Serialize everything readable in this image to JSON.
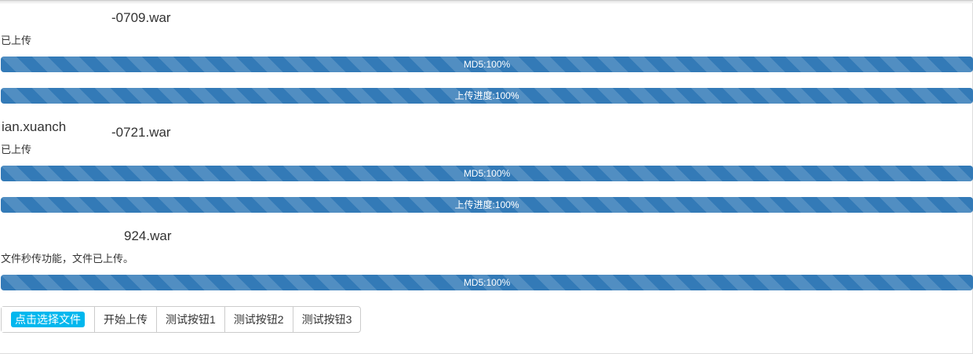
{
  "files": [
    {
      "name_visible": "-0709.war",
      "status": "已上传",
      "progress": [
        {
          "label": "MD5:100%",
          "percent": 100
        },
        {
          "label": "上传进度:100%",
          "percent": 100
        }
      ]
    },
    {
      "name_visible": "-0721.war",
      "name_prefix": "ian.xuanch",
      "status": "已上传",
      "progress": [
        {
          "label": "MD5:100%",
          "percent": 100
        },
        {
          "label": "上传进度:100%",
          "percent": 100
        }
      ]
    },
    {
      "name_visible": "924.war",
      "status": "文件秒传功能，文件已上传。",
      "progress": [
        {
          "label": "MD5:100%",
          "percent": 100
        }
      ]
    }
  ],
  "toolbar": {
    "pick_label": "点击选择文件",
    "start_label": "开始上传",
    "test1_label": "测试按钮1",
    "test2_label": "测试按钮2",
    "test3_label": "测试按钮3"
  },
  "colors": {
    "progress_bar": "#337ab7",
    "pick_button": "#00b7ee"
  }
}
